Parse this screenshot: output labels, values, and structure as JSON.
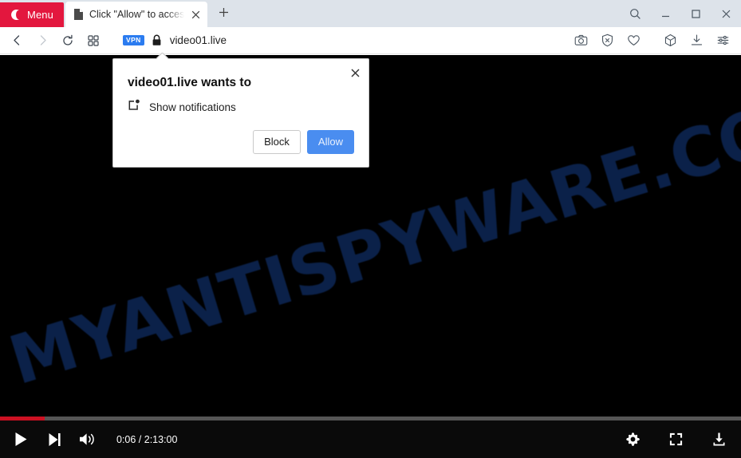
{
  "browser": {
    "menu_button": {
      "label": "Menu",
      "icon": "opera-logo-icon"
    },
    "tab": {
      "title": "Click \"Allow\" to acces",
      "favicon": "page-icon",
      "close_icon": "close-icon"
    },
    "new_tab_icon": "plus-icon",
    "window_controls": [
      {
        "name": "search",
        "icon": "search-icon"
      },
      {
        "name": "minimize",
        "icon": "minimize-icon"
      },
      {
        "name": "maximize",
        "icon": "maximize-icon"
      },
      {
        "name": "close",
        "icon": "close-icon"
      }
    ],
    "toolbar": {
      "back_icon": "back-arrow-icon",
      "forward_icon": "forward-arrow-icon",
      "reload_icon": "reload-icon",
      "speeddial_icon": "grid-icon",
      "vpn_badge": "VPN",
      "lock_icon": "lock-icon",
      "address": "video01.live",
      "right_icons": [
        {
          "name": "snapshot",
          "icon": "camera-icon"
        },
        {
          "name": "ad-blocker",
          "icon": "shield-x-icon"
        },
        {
          "name": "favorites",
          "icon": "heart-icon"
        },
        {
          "name": "extensions",
          "icon": "cube-icon"
        },
        {
          "name": "downloads",
          "icon": "download-icon"
        },
        {
          "name": "easy-setup",
          "icon": "sliders-icon"
        }
      ]
    }
  },
  "page": {
    "watermark": "MYANTISPYWARE.COM",
    "watermark_color": "#0b2149",
    "background_color": "#000000"
  },
  "player": {
    "progress_percent": 6,
    "buffer_percent": 100,
    "progress_color": "#cc1122",
    "play_icon": "play-icon",
    "next_icon": "next-track-icon",
    "volume_icon": "volume-high-icon",
    "time_display": "0:06 / 2:13:00",
    "current_time": "0:06",
    "duration": "2:13:00",
    "settings_icon": "gear-icon",
    "fullscreen_icon": "fullscreen-icon",
    "download_icon": "download-icon"
  },
  "dialog": {
    "title": "video01.live wants to",
    "permission_icon": "notification-icon",
    "permission_label": "Show notifications",
    "close_icon": "close-icon",
    "block_label": "Block",
    "allow_label": "Allow",
    "allow_color": "#4a8df0"
  }
}
